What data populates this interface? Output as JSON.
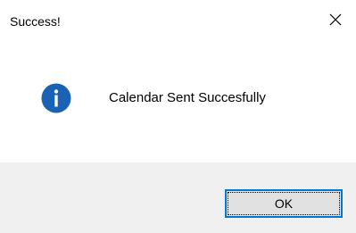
{
  "dialog": {
    "title": "Success!",
    "close_icon": "close-icon",
    "info_icon": "information-icon",
    "message": "Calendar Sent Succesfully",
    "ok_label": "OK"
  },
  "colors": {
    "info_icon_fill": "#1a62b3",
    "button_border_focus": "#0078d7",
    "button_bar_background": "#f0f0f0",
    "button_background": "#e1e1e1"
  }
}
